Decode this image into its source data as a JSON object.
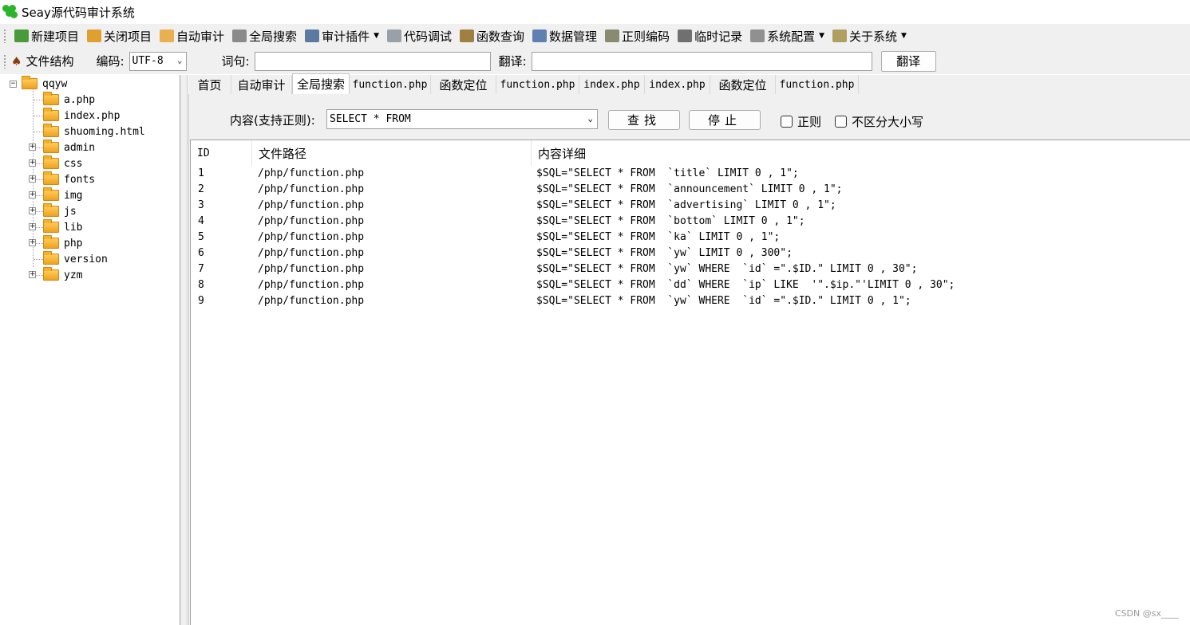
{
  "window": {
    "title": "Seay源代码审计系统"
  },
  "menubar": {
    "items": [
      {
        "label": "新建项目",
        "icon": "new-project-icon",
        "color": "#4a9a3a"
      },
      {
        "label": "关闭项目",
        "icon": "close-project-icon",
        "color": "#e0a030"
      },
      {
        "label": "自动审计",
        "icon": "auto-audit-icon",
        "color": "#e8b050"
      },
      {
        "label": "全局搜索",
        "icon": "global-search-icon",
        "color": "#8a8a8a"
      },
      {
        "label": "审计插件",
        "icon": "plugin-icon",
        "color": "#5a7aa0",
        "dropdown": true
      },
      {
        "label": "代码调试",
        "icon": "debug-icon",
        "color": "#9aa0a8"
      },
      {
        "label": "函数查询",
        "icon": "function-search-icon",
        "color": "#a08040"
      },
      {
        "label": "数据管理",
        "icon": "data-manage-icon",
        "color": "#6080b0"
      },
      {
        "label": "正则编码",
        "icon": "regex-encode-icon",
        "color": "#8a8a70"
      },
      {
        "label": "临时记录",
        "icon": "temp-record-icon",
        "color": "#707070"
      },
      {
        "label": "系统配置",
        "icon": "gear-icon",
        "color": "#909090",
        "dropdown": true
      },
      {
        "label": "关于系统",
        "icon": "about-icon",
        "color": "#b0a060",
        "dropdown": true
      }
    ]
  },
  "toolbar2": {
    "file_structure_label": "文件结构",
    "encoding_label": "编码:",
    "encoding_value": "UTF-8",
    "word_label": "词句:",
    "word_value": "",
    "translate_label": "翻译:",
    "translate_value": "",
    "translate_button": "翻译"
  },
  "tree": {
    "root": "qqyw",
    "children": [
      {
        "label": "a.php",
        "expandable": false
      },
      {
        "label": "index.php",
        "expandable": false
      },
      {
        "label": "shuoming.html",
        "expandable": false
      },
      {
        "label": "admin",
        "expandable": true
      },
      {
        "label": "css",
        "expandable": true
      },
      {
        "label": "fonts",
        "expandable": true
      },
      {
        "label": "img",
        "expandable": true
      },
      {
        "label": "js",
        "expandable": true
      },
      {
        "label": "lib",
        "expandable": true
      },
      {
        "label": "php",
        "expandable": true
      },
      {
        "label": "version",
        "expandable": false
      },
      {
        "label": "yzm",
        "expandable": true
      }
    ]
  },
  "tabs": [
    {
      "label": "首页",
      "active": false
    },
    {
      "label": "自动审计",
      "active": false
    },
    {
      "label": "全局搜索",
      "active": true
    },
    {
      "label": "function.php",
      "active": false
    },
    {
      "label": "函数定位",
      "active": false
    },
    {
      "label": "function.php",
      "active": false
    },
    {
      "label": "index.php",
      "active": false
    },
    {
      "label": "index.php",
      "active": false
    },
    {
      "label": "函数定位",
      "active": false
    },
    {
      "label": "function.php",
      "active": false
    }
  ],
  "search": {
    "label": "内容(支持正则):",
    "value": "SELECT * FROM",
    "find_button": "查找",
    "stop_button": "停止",
    "regex_label": "正则",
    "case_insensitive_label": "不区分大小写"
  },
  "results": {
    "columns": [
      "ID",
      "文件路径",
      "内容详细"
    ],
    "rows": [
      {
        "id": "1",
        "path": "/php/function.php",
        "detail": "$SQL=\"SELECT * FROM  `title` LIMIT 0 , 1\";"
      },
      {
        "id": "2",
        "path": "/php/function.php",
        "detail": "$SQL=\"SELECT * FROM  `announcement` LIMIT 0 , 1\";"
      },
      {
        "id": "3",
        "path": "/php/function.php",
        "detail": "$SQL=\"SELECT * FROM  `advertising` LIMIT 0 , 1\";"
      },
      {
        "id": "4",
        "path": "/php/function.php",
        "detail": "$SQL=\"SELECT * FROM  `bottom` LIMIT 0 , 1\";"
      },
      {
        "id": "5",
        "path": "/php/function.php",
        "detail": "$SQL=\"SELECT * FROM  `ka` LIMIT 0 , 1\";"
      },
      {
        "id": "6",
        "path": "/php/function.php",
        "detail": "$SQL=\"SELECT * FROM  `yw` LIMIT 0 , 300\";"
      },
      {
        "id": "7",
        "path": "/php/function.php",
        "detail": "$SQL=\"SELECT * FROM  `yw` WHERE  `id` =\".$ID.\" LIMIT 0 , 30\";"
      },
      {
        "id": "8",
        "path": "/php/function.php",
        "detail": "$SQL=\"SELECT * FROM  `dd` WHERE  `ip` LIKE  '\".$ip.\"'LIMIT 0 , 30\";"
      },
      {
        "id": "9",
        "path": "/php/function.php",
        "detail": "$SQL=\"SELECT * FROM  `yw` WHERE  `id` =\".$ID.\" LIMIT 0 , 1\";"
      }
    ]
  },
  "watermark": "CSDN @sx____"
}
